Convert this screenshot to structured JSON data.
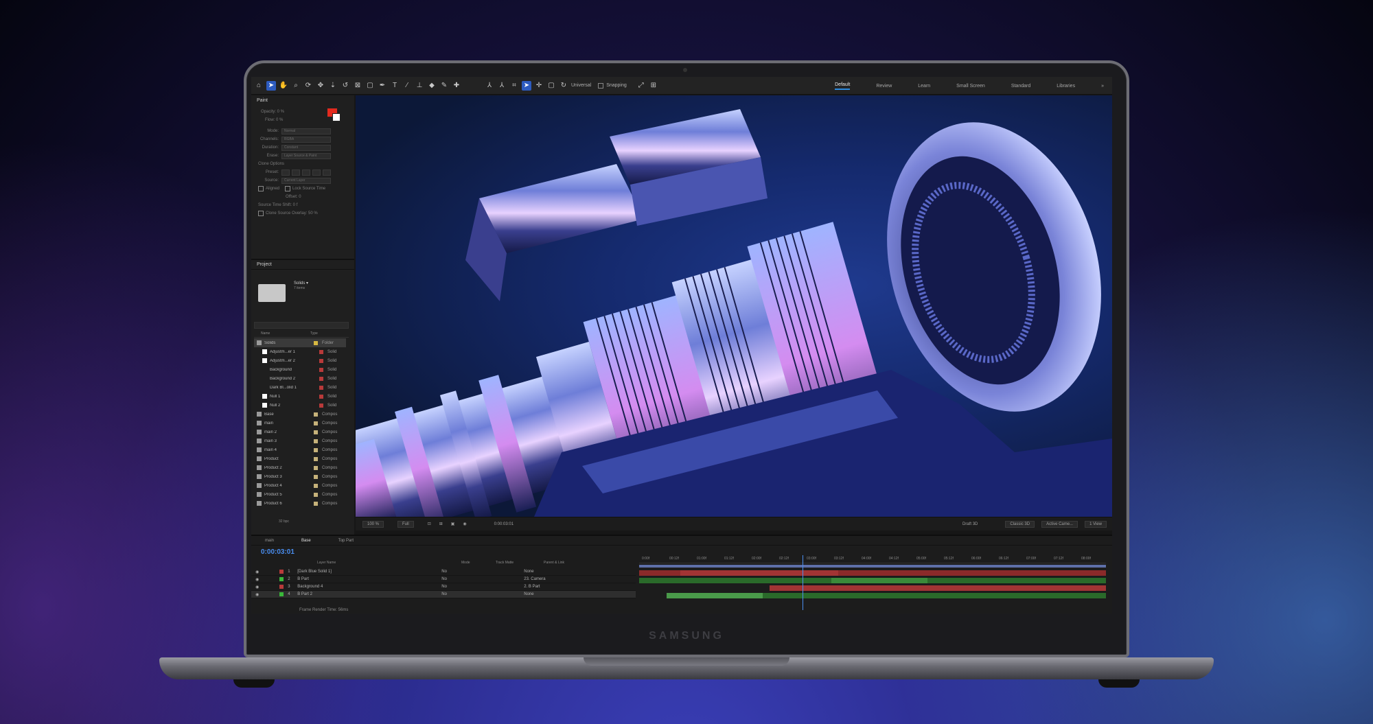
{
  "device": {
    "brand": "SAMSUNG"
  },
  "toolbar": {
    "universal_label": "Universal",
    "snapping_label": "Snapping"
  },
  "workspaces": [
    {
      "label": "Default",
      "active": true
    },
    {
      "label": "Review"
    },
    {
      "label": "Learn"
    },
    {
      "label": "Small Screen"
    },
    {
      "label": "Standard"
    },
    {
      "label": "Libraries"
    }
  ],
  "paint": {
    "title": "Paint",
    "opacity": "Opacity: 0 %",
    "flow": "Flow: 0 %",
    "mode_label": "Mode:",
    "mode_value": "Normal",
    "channels_label": "Channels:",
    "channels_value": "RGBA",
    "duration_label": "Duration:",
    "duration_value": "Constant",
    "erase_label": "Erase:",
    "erase_value": "Layer Source & Paint",
    "clone_options": "Clone Options",
    "preset_label": "Preset:",
    "source_label": "Source:",
    "source_value": "Current Layer",
    "aligned": "Aligned",
    "lock_source_time": "Lock Source Time",
    "offset": "Offset: 0",
    "source_time_shift": "Source Time Shift: 0 f",
    "clone_source_overlay": "Clone Source Overlay: 50 %",
    "fg_color": "#e32a1e",
    "bg_color": "#ffffff"
  },
  "project": {
    "title": "Project",
    "folder_name": "Solids ▾",
    "folder_items": "7 items",
    "col_name": "Name",
    "col_type": "Type",
    "items": [
      {
        "name": "Solids",
        "type": "Folder",
        "color": "#d6b842",
        "sel": true
      },
      {
        "name": "Adjustm...er 1",
        "type": "Solid",
        "color": "#b83a3a",
        "swatch": "#ffffff"
      },
      {
        "name": "Adjustm...er 2",
        "type": "Solid",
        "color": "#b83a3a",
        "swatch": "#ffffff"
      },
      {
        "name": "Background",
        "type": "Solid",
        "color": "#b83a3a",
        "swatch": "#1f1f1f"
      },
      {
        "name": "Background 2",
        "type": "Solid",
        "color": "#b83a3a",
        "swatch": "#1f1f1f"
      },
      {
        "name": "Dark Bl...olid 1",
        "type": "Solid",
        "color": "#b83a3a",
        "swatch": "#1f1f1f"
      },
      {
        "name": "Null 1",
        "type": "Solid",
        "color": "#b83a3a",
        "swatch": "#ffffff"
      },
      {
        "name": "Null 2",
        "type": "Solid",
        "color": "#b83a3a",
        "swatch": "#ffffff"
      },
      {
        "name": "Base",
        "type": "Compos",
        "color": "#c6b27a"
      },
      {
        "name": "main",
        "type": "Compos",
        "color": "#c6b27a"
      },
      {
        "name": "main 2",
        "type": "Compos",
        "color": "#c6b27a"
      },
      {
        "name": "main 3",
        "type": "Compos",
        "color": "#c6b27a"
      },
      {
        "name": "main 4",
        "type": "Compos",
        "color": "#c6b27a"
      },
      {
        "name": "Product",
        "type": "Compos",
        "color": "#c6b27a"
      },
      {
        "name": "Product 2",
        "type": "Compos",
        "color": "#c6b27a"
      },
      {
        "name": "Product 3",
        "type": "Compos",
        "color": "#c6b27a"
      },
      {
        "name": "Product 4",
        "type": "Compos",
        "color": "#c6b27a"
      },
      {
        "name": "Product 5",
        "type": "Compos",
        "color": "#c6b27a"
      },
      {
        "name": "Product 6",
        "type": "Compos",
        "color": "#c6b27a"
      }
    ],
    "bpc": "32 bpc"
  },
  "viewer": {
    "zoom": "100 %",
    "resolution": "Full",
    "time": "0:00:03:01",
    "renderer": "Draft 3D",
    "view_mode": "Classic 3D",
    "camera": "Active Came...",
    "views": "1 View"
  },
  "timeline": {
    "tabs": [
      {
        "label": "main"
      },
      {
        "label": "Base",
        "active": true
      },
      {
        "label": "Top Part"
      }
    ],
    "timecode": "0:00:03:01",
    "header_layer_name": "Layer Name",
    "header_mode": "Mode",
    "header_trkmat": "Track Matte",
    "header_parent": "Parent & Link",
    "layers": [
      {
        "num": "1",
        "name": "[Dark Blue Solid 1]",
        "mode": "No",
        "parent": "None",
        "color": "#b83a3a"
      },
      {
        "num": "2",
        "name": "B Part",
        "mode": "No",
        "parent": "23. Camera",
        "color": "#3ab83a"
      },
      {
        "num": "3",
        "name": "Background 4",
        "mode": "No",
        "parent": "2. B Part",
        "color": "#b83a3a"
      },
      {
        "num": "4",
        "name": "B Part 2",
        "mode": "No",
        "parent": "None",
        "color": "#3ab83a",
        "sel": true
      }
    ],
    "ruler": [
      "0:00f",
      "00:12f",
      "01:00f",
      "01:12f",
      "02:00f",
      "02:12f",
      "03:00f",
      "03:12f",
      "04:00f",
      "04:12f",
      "05:00f",
      "05:12f",
      "06:00f",
      "06:12f",
      "07:00f",
      "07:12f",
      "08:00f"
    ],
    "frame_render_time": "Frame Render Time: 56ms"
  }
}
